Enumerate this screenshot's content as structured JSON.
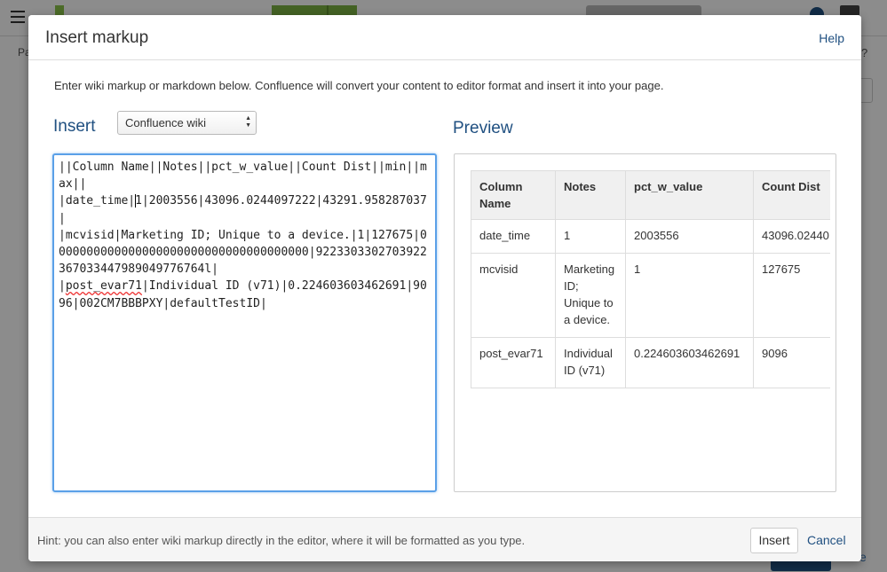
{
  "dialog": {
    "title": "Insert markup",
    "help_label": "Help",
    "intro": "Enter wiki markup or markdown below. Confluence will convert your content to editor format and insert it into your page.",
    "insert_heading": "Insert",
    "format_select": {
      "selected": "Confluence wiki"
    },
    "markup": {
      "before_cursor": "||Column Name||Notes||pct_w_value||Count Dist||min||max||\n|date_time|",
      "after_cursor": "1|2003556|43096.0244097222|43291.958287037|\n|mcvisid|Marketing ID; Unique to a device.|1|127675|0000000000000000000000000000000000000|9223303302703922367033447989049776764l|\n|",
      "misspelled": "post_evar71",
      "tail": "|Individual ID (v71)|0.224603603462691|9096|002CM7BBBPXY|defaultTestID|"
    },
    "preview_heading": "Preview",
    "preview": {
      "headers": [
        "Column Name",
        "Notes",
        "pct_w_value",
        "Count Dist"
      ],
      "rows": [
        [
          "date_time",
          "1",
          "2003556",
          "43096.02440"
        ],
        [
          "mcvisid",
          "Marketing ID; Unique to a device.",
          "1",
          "127675"
        ],
        [
          "post_evar71",
          "Individual ID (v71)",
          "0.224603603462691",
          "9096"
        ]
      ]
    },
    "footer": {
      "hint": "Hint: you can also enter wiki markup directly in the editor, where it will be formatted as you type.",
      "insert_label": "Insert",
      "cancel_label": "Cancel"
    }
  },
  "background": {
    "page_label": "Pa",
    "help_glyph": "?",
    "corner_text": "e"
  },
  "colors": {
    "link_blue": "#205081",
    "focus_border": "#5aa0e8",
    "overlay": "rgba(0,0,0,0.45)"
  }
}
